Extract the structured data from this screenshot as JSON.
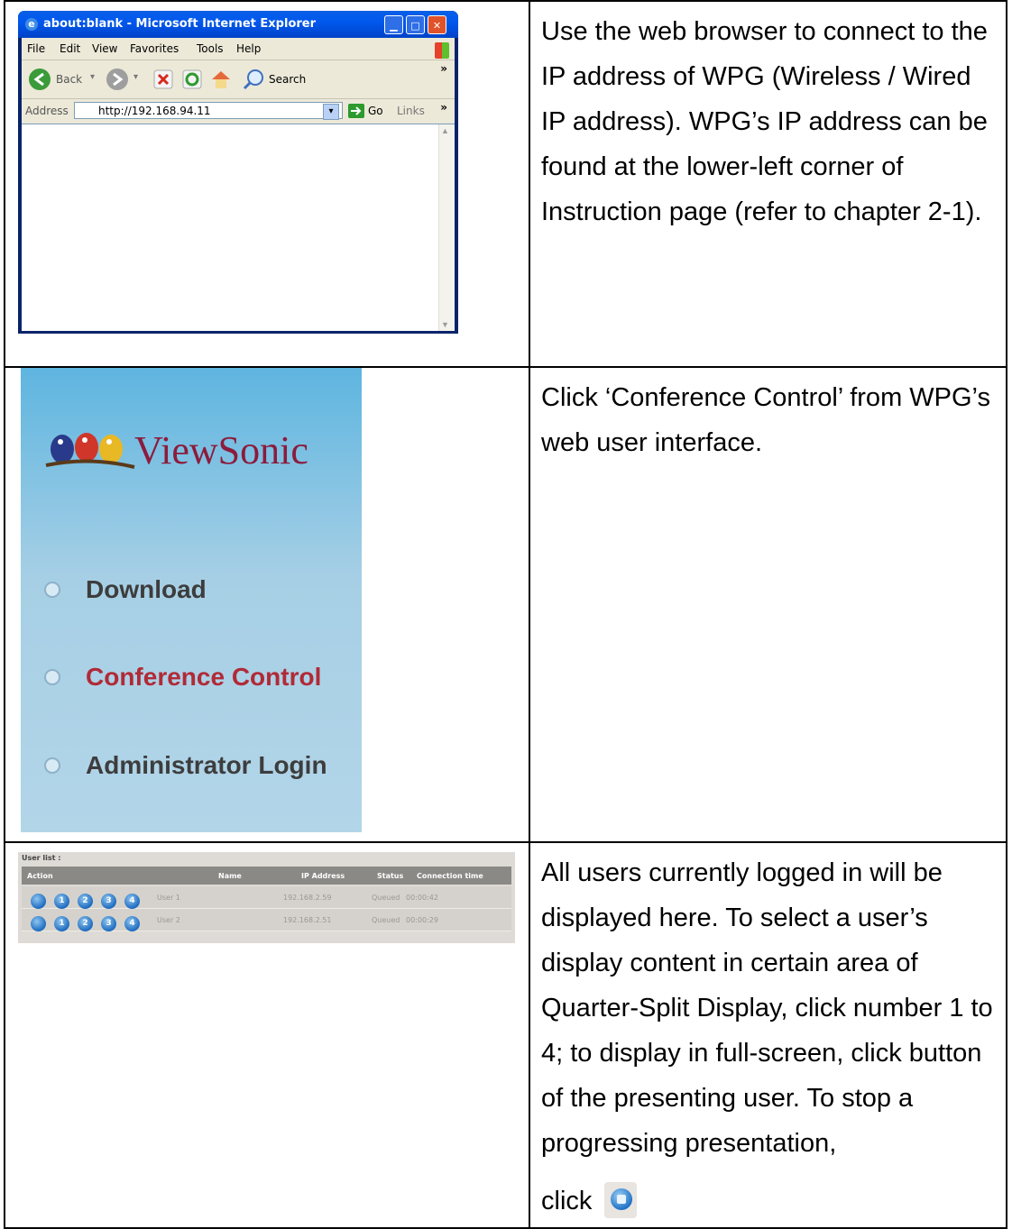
{
  "row1": {
    "browser": {
      "window_title": "about:blank - Microsoft Internet Explorer",
      "menu": [
        "File",
        "Edit",
        "View",
        "Favorites",
        "Tools",
        "Help"
      ],
      "toolbar": {
        "back": "Back",
        "search": "Search"
      },
      "address_label": "Address",
      "address_value": "http://192.168.94.11",
      "go": "Go",
      "links": "Links"
    },
    "text": "Use the web browser to connect to the IP address of WPG (Wireless / Wired IP address). WPG’s IP address can be found at the lower-left corner of Instruction page (refer to chapter 2-1)."
  },
  "row2": {
    "brand": "ViewSonic",
    "links": [
      "Download",
      "Conference Control",
      "Administrator Login"
    ],
    "colors": {
      "normal": "#3d3d3d",
      "active": "#b12a37"
    },
    "text": "Click ‘Conference Control’ from WPG’s web user interface."
  },
  "row3": {
    "user_list": {
      "title": "User list :",
      "headers": [
        "Action",
        "Name",
        "IP Address",
        "Status",
        "Connection time"
      ],
      "action_buttons": [
        "",
        "1",
        "2",
        "3",
        "4"
      ],
      "rows": [
        {
          "name": "User 1",
          "ip": "192.168.2.59",
          "status": "Queued",
          "time": "00:00:42"
        },
        {
          "name": "User 2",
          "ip": "192.168.2.51",
          "status": "Queued",
          "time": "00:00:29"
        }
      ]
    },
    "text": "All users currently logged in will be displayed here. To select a user’s display content in certain area of Quarter-Split Display, click number 1 to 4; to display in full-screen, click button of the presenting user. To stop a progressing presentation,",
    "click_label": "click"
  }
}
